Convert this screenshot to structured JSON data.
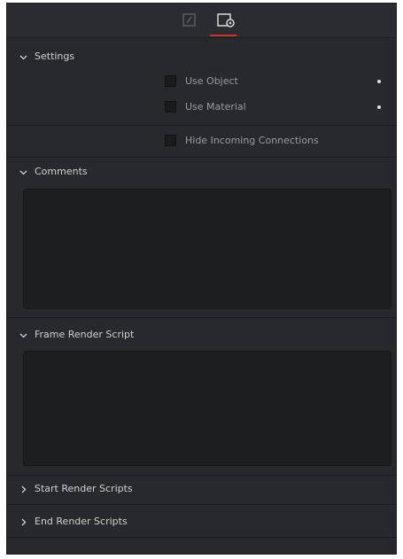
{
  "tabs": {
    "items": [
      {
        "icon": "edit-tab-icon"
      },
      {
        "icon": "settings-tab-icon",
        "active": true
      }
    ],
    "accent_color": "#c7352e"
  },
  "settings": {
    "header": "Settings",
    "use_object_label": "Use Object",
    "use_material_label": "Use Material",
    "hide_incoming_label": "Hide Incoming Connections"
  },
  "comments": {
    "header": "Comments",
    "value": ""
  },
  "frame_render_script": {
    "header": "Frame Render Script",
    "value": ""
  },
  "start_render_scripts": {
    "header": "Start Render Scripts"
  },
  "end_render_scripts": {
    "header": "End Render Scripts"
  },
  "colors": {
    "panel_bg": "#27292c",
    "field_bg": "#1d1e20",
    "text": "#c8c9cb"
  }
}
